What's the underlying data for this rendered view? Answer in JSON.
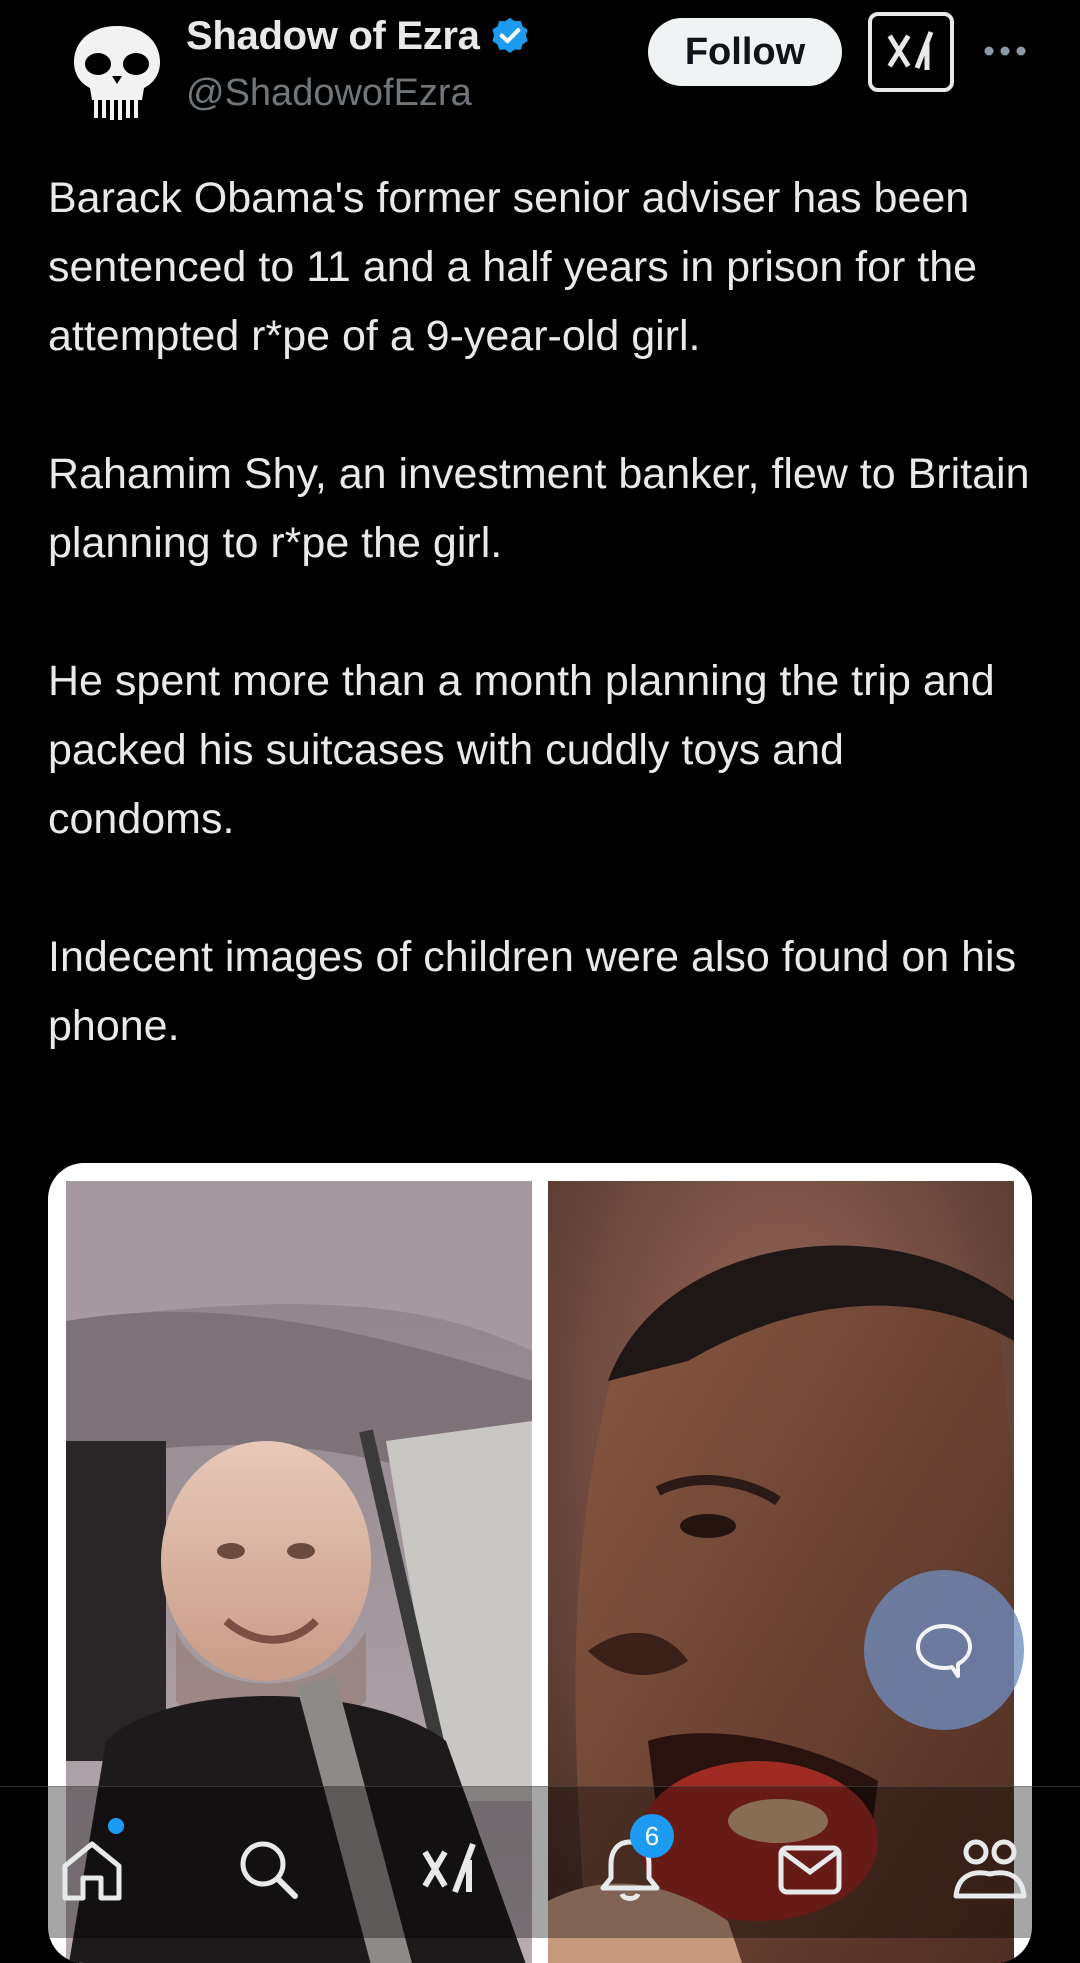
{
  "author": {
    "display_name": "Shadow of Ezra",
    "handle": "@ShadowofEzra",
    "verified": true,
    "avatar_icon": "punisher-skull-icon"
  },
  "header": {
    "follow_label": "Follow",
    "grok_icon": "grok-icon",
    "more_icon": "more-dots-icon"
  },
  "tweet": {
    "paragraphs": [
      "Barack Obama's former senior adviser has been sentenced to 11 and a half years in prison for the attempted r*pe of a 9-year-old girl.",
      "Rahamim Shy, an investment banker, flew to Britain planning to r*pe the girl.",
      "He spent more than a month planning the trip and packed his suitcases with cuddly toys and condoms.",
      "Indecent images of children were also found on his phone."
    ]
  },
  "fab": {
    "icon": "compose-reply-icon"
  },
  "bottom_nav": {
    "items": [
      {
        "icon": "home-icon",
        "has_dot": true
      },
      {
        "icon": "search-icon"
      },
      {
        "icon": "grok-icon"
      },
      {
        "icon": "notifications-icon",
        "badge": "6"
      },
      {
        "icon": "messages-icon"
      },
      {
        "icon": "communities-icon"
      }
    ]
  },
  "colors": {
    "background": "#000000",
    "text": "#e7e9ea",
    "muted": "#71767b",
    "accent": "#1d9bf0"
  }
}
